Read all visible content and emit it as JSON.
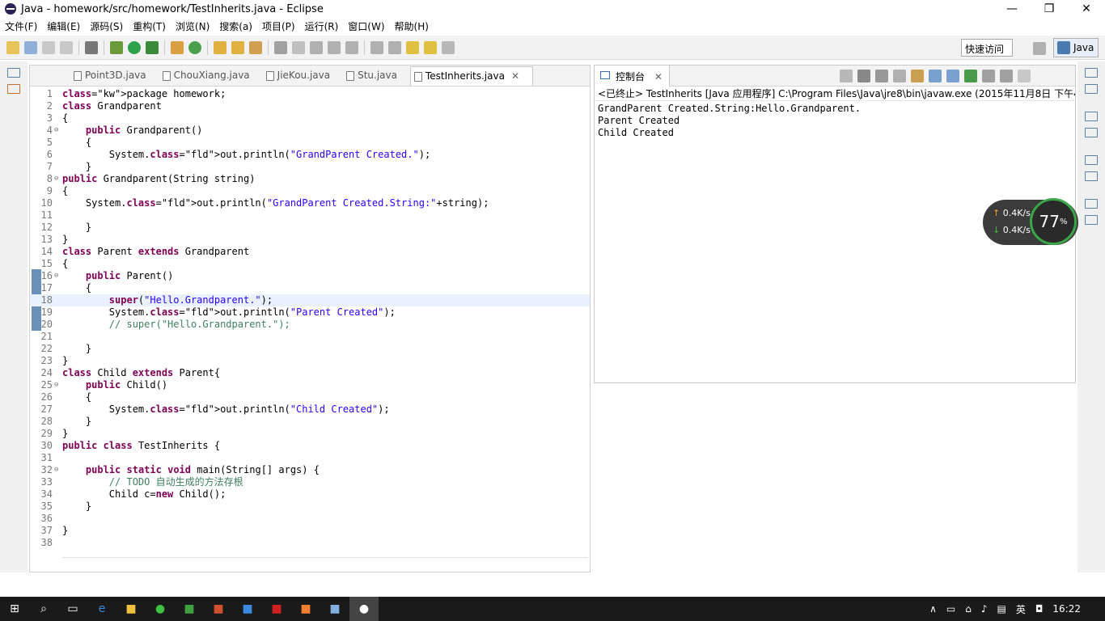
{
  "window": {
    "title": "Java - homework/src/homework/TestInherits.java - Eclipse",
    "min": "—",
    "max": "❐",
    "close": "✕"
  },
  "menu": [
    "文件(F)",
    "编辑(E)",
    "源码(S)",
    "重构(T)",
    "浏览(N)",
    "搜索(a)",
    "项目(P)",
    "运行(R)",
    "窗口(W)",
    "帮助(H)"
  ],
  "toolbar": {
    "quick_access": "快速访问",
    "perspective": "Java"
  },
  "editor": {
    "tabs": [
      {
        "label": "Point3D.java"
      },
      {
        "label": "ChouXiang.java"
      },
      {
        "label": "JieKou.java"
      },
      {
        "label": "Stu.java"
      },
      {
        "label": "TestInherits.java",
        "close": "✕"
      }
    ],
    "lines": [
      {
        "n": "1",
        "t": "package homework;"
      },
      {
        "n": "2",
        "t": "class Grandparent"
      },
      {
        "n": "3",
        "t": "{"
      },
      {
        "n": "4",
        "t": "    public Grandparent()",
        "fold": "⊖"
      },
      {
        "n": "5",
        "t": "    {"
      },
      {
        "n": "6",
        "t": "        System.out.println(\"GrandParent Created.\");"
      },
      {
        "n": "7",
        "t": "    }"
      },
      {
        "n": "8",
        "t": "public Grandparent(String string)",
        "fold": "⊖"
      },
      {
        "n": "9",
        "t": "{"
      },
      {
        "n": "10",
        "t": "    System.out.println(\"GrandParent Created.String:\"+string);"
      },
      {
        "n": "11",
        "t": ""
      },
      {
        "n": "12",
        "t": "    }"
      },
      {
        "n": "13",
        "t": "}"
      },
      {
        "n": "14",
        "t": "class Parent extends Grandparent"
      },
      {
        "n": "15",
        "t": "{"
      },
      {
        "n": "16",
        "t": "    public Parent()",
        "fold": "⊖"
      },
      {
        "n": "17",
        "t": "    {"
      },
      {
        "n": "18",
        "t": "        super(\"Hello.Grandparent.\");",
        "hl": true
      },
      {
        "n": "19",
        "t": "        System.out.println(\"Parent Created\");"
      },
      {
        "n": "20",
        "t": "        // super(\"Hello.Grandparent.\");"
      },
      {
        "n": "21",
        "t": ""
      },
      {
        "n": "22",
        "t": "    }"
      },
      {
        "n": "23",
        "t": "}"
      },
      {
        "n": "24",
        "t": "class Child extends Parent{"
      },
      {
        "n": "25",
        "t": "    public Child()",
        "fold": "⊖"
      },
      {
        "n": "26",
        "t": "    {"
      },
      {
        "n": "27",
        "t": "        System.out.println(\"Child Created\");"
      },
      {
        "n": "28",
        "t": "    }"
      },
      {
        "n": "29",
        "t": "}"
      },
      {
        "n": "30",
        "t": "public class TestInherits {"
      },
      {
        "n": "31",
        "t": ""
      },
      {
        "n": "32",
        "t": "    public static void main(String[] args) {",
        "fold": "⊖"
      },
      {
        "n": "33",
        "t": "        // TODO 自动生成的方法存根"
      },
      {
        "n": "34",
        "t": "        Child c=new Child();"
      },
      {
        "n": "35",
        "t": "    }"
      },
      {
        "n": "36",
        "t": ""
      },
      {
        "n": "37",
        "t": "}"
      },
      {
        "n": "38",
        "t": ""
      }
    ]
  },
  "console": {
    "tab": "控制台",
    "tab_close": "✕",
    "status": "<已终止> TestInherits [Java 应用程序] C:\\Program Files\\Java\\jre8\\bin\\javaw.exe (2015年11月8日 下午4:2",
    "output": [
      "GrandParent Created.String:Hello.Grandparent.",
      "Parent Created",
      "Child Created"
    ]
  },
  "network": {
    "up": "0.4K/s",
    "down": "0.4K/s",
    "percent": "77"
  },
  "taskbar": {
    "ime": "英",
    "time": "16:22"
  }
}
